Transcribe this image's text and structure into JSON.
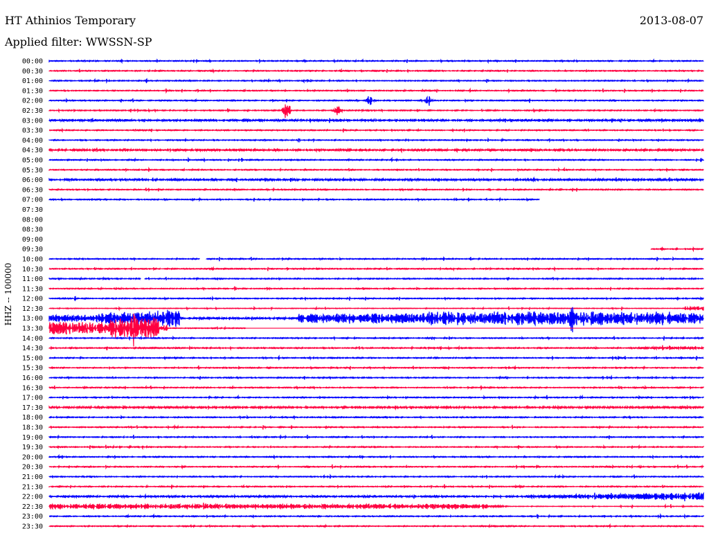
{
  "header": {
    "station": "HT Athinios Temporary",
    "filter": "Applied filter: WWSSN-SP",
    "date": "2013-08-07"
  },
  "chart_data": {
    "type": "line",
    "title": "HT Athinios Temporary",
    "subtitle": "Applied filter: WWSSN-SP",
    "date": "2013-08-07",
    "ylabel": "HHZ -- 100000",
    "xlabel": "",
    "row_labels": [
      "00:00",
      "00:30",
      "01:00",
      "01:30",
      "02:00",
      "02:30",
      "03:00",
      "03:30",
      "04:00",
      "04:30",
      "05:00",
      "05:30",
      "06:00",
      "06:30",
      "07:00",
      "07:30",
      "08:00",
      "08:30",
      "09:00",
      "09:30",
      "10:00",
      "10:30",
      "11:00",
      "11:30",
      "12:00",
      "12:30",
      "13:00",
      "13:30",
      "14:00",
      "14:30",
      "15:00",
      "15:30",
      "16:00",
      "16:30",
      "17:00",
      "17:30",
      "18:00",
      "18:30",
      "19:00",
      "19:30",
      "20:00",
      "20:30",
      "21:00",
      "21:30",
      "22:00",
      "22:30",
      "23:00",
      "23:30"
    ],
    "series_colors": [
      "#0000ff",
      "#ff0040"
    ],
    "notes": "Helicorder: 30-minute rows, alternating blue/red traces; rows 07:30-09:00 have no data; 07:00 row ends at ~0.75 of row; 09:30 row starts at ~0.92 of row; strong shaking in 12:30-13:30 rows; events in 02:00 and 02:30 rows.",
    "gaps": [
      {
        "row": "07:00",
        "data_until_fraction": 0.75
      },
      {
        "row": "09:30",
        "data_from_fraction": 0.92
      },
      {
        "row": "11:00",
        "gap_fraction": [
          0.14,
          0.145
        ]
      },
      {
        "row": "10:00",
        "gap_fraction": [
          0.23,
          0.24
        ]
      }
    ],
    "events": [
      {
        "row": "02:00",
        "at_fraction": 0.49,
        "peak_rows": 0.6
      },
      {
        "row": "02:00",
        "at_fraction": 0.58,
        "peak_rows": 0.6
      },
      {
        "row": "02:30",
        "at_fraction": 0.363,
        "peak_rows": 1.2
      },
      {
        "row": "02:30",
        "at_fraction": 0.442,
        "peak_rows": 0.7
      },
      {
        "row": "13:00",
        "at_fraction": 0.8,
        "peak_rows": 2.3
      },
      {
        "row": "13:30",
        "at_fraction": 0.13,
        "peak_rows": 2.5
      }
    ]
  }
}
